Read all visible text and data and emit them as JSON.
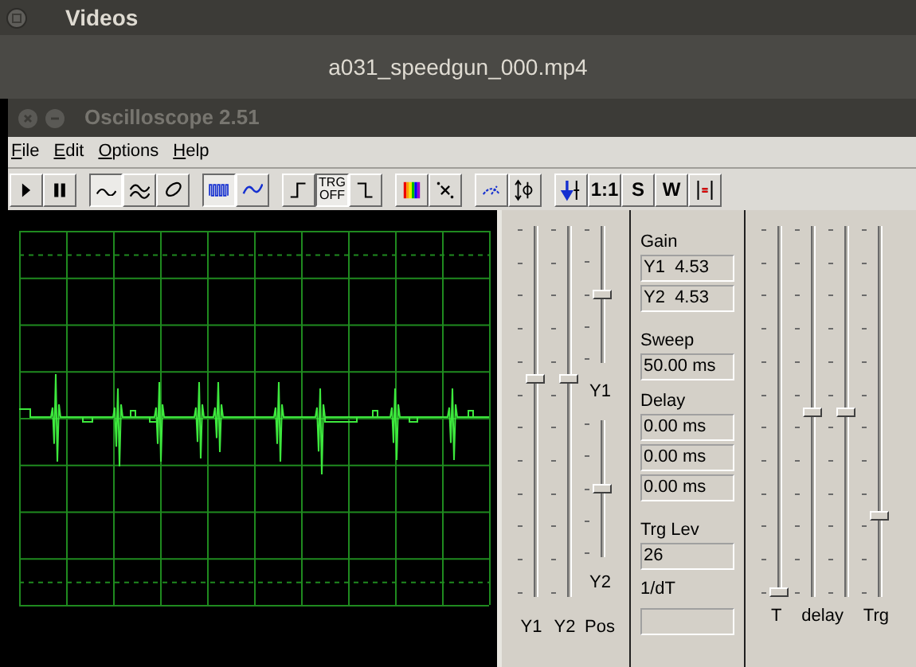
{
  "player": {
    "title": "Videos",
    "file_name": "a031_speedgun_000.mp4"
  },
  "window": {
    "title": "Oscilloscope 2.51"
  },
  "menu": [
    {
      "label": "File"
    },
    {
      "label": "Edit"
    },
    {
      "label": "Options"
    },
    {
      "label": "Help"
    }
  ],
  "toolbar": [
    [
      {
        "kind": "play",
        "selected": false
      },
      {
        "kind": "pause",
        "selected": false
      }
    ],
    [
      {
        "kind": "sine",
        "selected": true
      },
      {
        "kind": "dual_sine",
        "selected": false
      },
      {
        "kind": "lissajous",
        "selected": false
      }
    ],
    [
      {
        "kind": "square_blue",
        "selected": true
      },
      {
        "kind": "sine_blue",
        "selected": false
      }
    ],
    [
      {
        "kind": "rising_edge",
        "selected": false
      },
      {
        "kind": "text",
        "label": "TRG OFF",
        "selected": true
      },
      {
        "kind": "falling_edge",
        "selected": false
      }
    ],
    [
      {
        "kind": "spectrum",
        "selected": false
      },
      {
        "kind": "cursor",
        "selected": false
      }
    ],
    [
      {
        "kind": "meter",
        "selected": false
      },
      {
        "kind": "phase",
        "selected": false
      }
    ],
    [
      {
        "kind": "down_arrow",
        "selected": false
      },
      {
        "kind": "text",
        "label": "1:1",
        "selected": false
      },
      {
        "kind": "text",
        "label": "S",
        "selected": false
      },
      {
        "kind": "text",
        "label": "W",
        "selected": false
      },
      {
        "kind": "marker",
        "selected": false
      }
    ]
  ],
  "left_sliders": [
    {
      "label": "Y1",
      "level": 0.59
    },
    {
      "label": "Y2",
      "level": 0.59
    }
  ],
  "pos_sliders": [
    {
      "label": "Y1",
      "level": 0.5
    },
    {
      "label": "Y2",
      "level": 0.5
    }
  ],
  "pos_label": "Pos",
  "readouts": {
    "gain_label": "Gain",
    "gain": [
      "Y1  4.53",
      "Y2  4.53"
    ],
    "sweep_label": "Sweep",
    "sweep": "50.00 ms",
    "delay_label": "Delay",
    "delay": [
      "0.00 ms",
      "0.00 ms",
      "0.00 ms"
    ],
    "trg_lev_label": "Trg Lev",
    "trg_lev": "26",
    "inv_dt_label": "1/dT"
  },
  "right_sliders": [
    {
      "level": 0.0
    },
    {
      "level": 0.5
    },
    {
      "level": 0.5
    },
    {
      "level": 0.21
    }
  ],
  "right_labels": [
    "T",
    "delay",
    "Trg"
  ]
}
